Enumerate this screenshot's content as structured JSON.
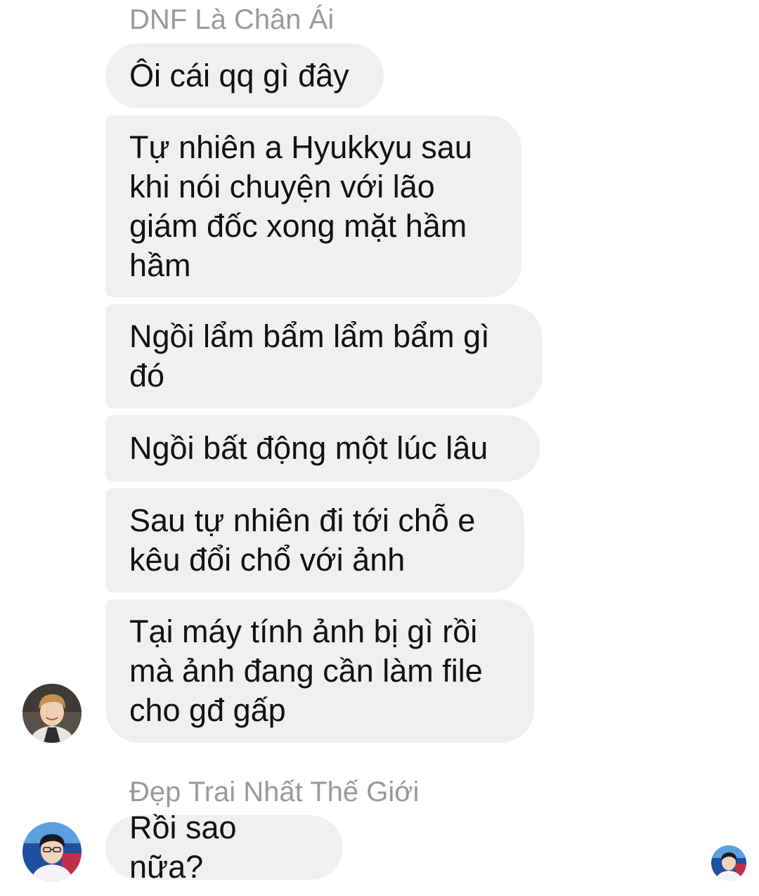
{
  "thread": {
    "groups": [
      {
        "sender": "DNF Là Chân Ái",
        "avatar_icon": "person-photo-icon",
        "messages": [
          "Ôi cái qq gì đây",
          "Tự nhiên a Hyukkyu sau khi nói chuyện với lão giám đốc xong mặt hầm hầm",
          "Ngồi lẩm bẩm lẩm bẩm gì đó",
          "Ngồi bất động một lúc lâu",
          "Sau tự nhiên đi tới chỗ e kêu đổi chổ với ảnh",
          "Tại máy tính ảnh bị gì rồi mà ảnh đang cần làm file cho gđ gấp"
        ]
      },
      {
        "sender": "Đẹp Trai Nhất Thế Giới",
        "avatar_icon": "person-photo-icon",
        "messages": [
          "Rồi sao nữa?"
        ]
      }
    ],
    "read_receipt_icon": "read-receipt-avatar-icon"
  },
  "colors": {
    "bubble_bg": "#f0f0f0",
    "sender_name": "#9a9a9e",
    "text": "#111111",
    "background": "#ffffff"
  }
}
